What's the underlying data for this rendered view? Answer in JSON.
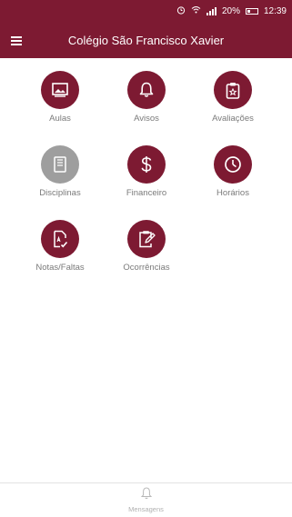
{
  "status_bar": {
    "battery": "20%",
    "time": "12:39",
    "icons": [
      "alarm-icon",
      "wifi-icon",
      "signal-icon",
      "battery-icon"
    ]
  },
  "app_bar": {
    "title": "Colégio São Francisco Xavier",
    "menu_icon": "hamburger-menu-icon"
  },
  "tiles": [
    {
      "label": "Aulas",
      "icon": "image-icon",
      "color": "#7d1a32"
    },
    {
      "label": "Avisos",
      "icon": "bell-icon",
      "color": "#7d1a32"
    },
    {
      "label": "Avaliações",
      "icon": "clipboard-star-icon",
      "color": "#7d1a32"
    },
    {
      "label": "Disciplinas",
      "icon": "notebook-icon",
      "color": "#9e9e9e"
    },
    {
      "label": "Financeiro",
      "icon": "dollar-icon",
      "color": "#7d1a32"
    },
    {
      "label": "Horários",
      "icon": "clock-icon",
      "color": "#7d1a32"
    },
    {
      "label": "Notas/Faltas",
      "icon": "grade-document-icon",
      "color": "#7d1a32"
    },
    {
      "label": "Ocorrências",
      "icon": "edit-clipboard-icon",
      "color": "#7d1a32"
    }
  ],
  "bottom_nav": {
    "label": "Mensagens",
    "icon": "bell-outline-icon"
  },
  "colors": {
    "primary": "#7d1a32",
    "disabled": "#9e9e9e",
    "label": "#7a7a7a"
  }
}
